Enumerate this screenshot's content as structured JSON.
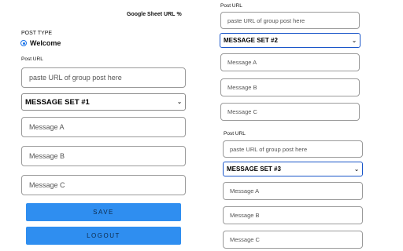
{
  "header": {
    "sheet_link_label": "Google Sheet URL",
    "sheet_link_icon": "link-icon"
  },
  "post_type": {
    "label": "POST TYPE",
    "selected": "Welcome"
  },
  "left": {
    "post_url_label": "Post URL",
    "post_url_placeholder": "paste URL of group post here",
    "message_set": "MESSAGE SET #1",
    "messages": [
      "Message A",
      "Message B",
      "Message C"
    ]
  },
  "right_top": {
    "post_url_label": "Post URL",
    "post_url_placeholder": "paste URL of group post here",
    "message_set": "MESSAGE SET #2",
    "messages": [
      "Message A",
      "Message B",
      "Message C"
    ]
  },
  "right_bottom": {
    "post_url_label": "Post URL",
    "post_url_placeholder": "paste URL of group post here",
    "message_set": "MESSAGE SET #3",
    "messages": [
      "Message A",
      "Message B",
      "Message C"
    ]
  },
  "buttons": {
    "save": "SAVE",
    "logout": "LOGOUT"
  },
  "colors": {
    "accent": "#2f8ef0",
    "focus_border": "#1a56c9",
    "radio": "#1a73e8"
  }
}
